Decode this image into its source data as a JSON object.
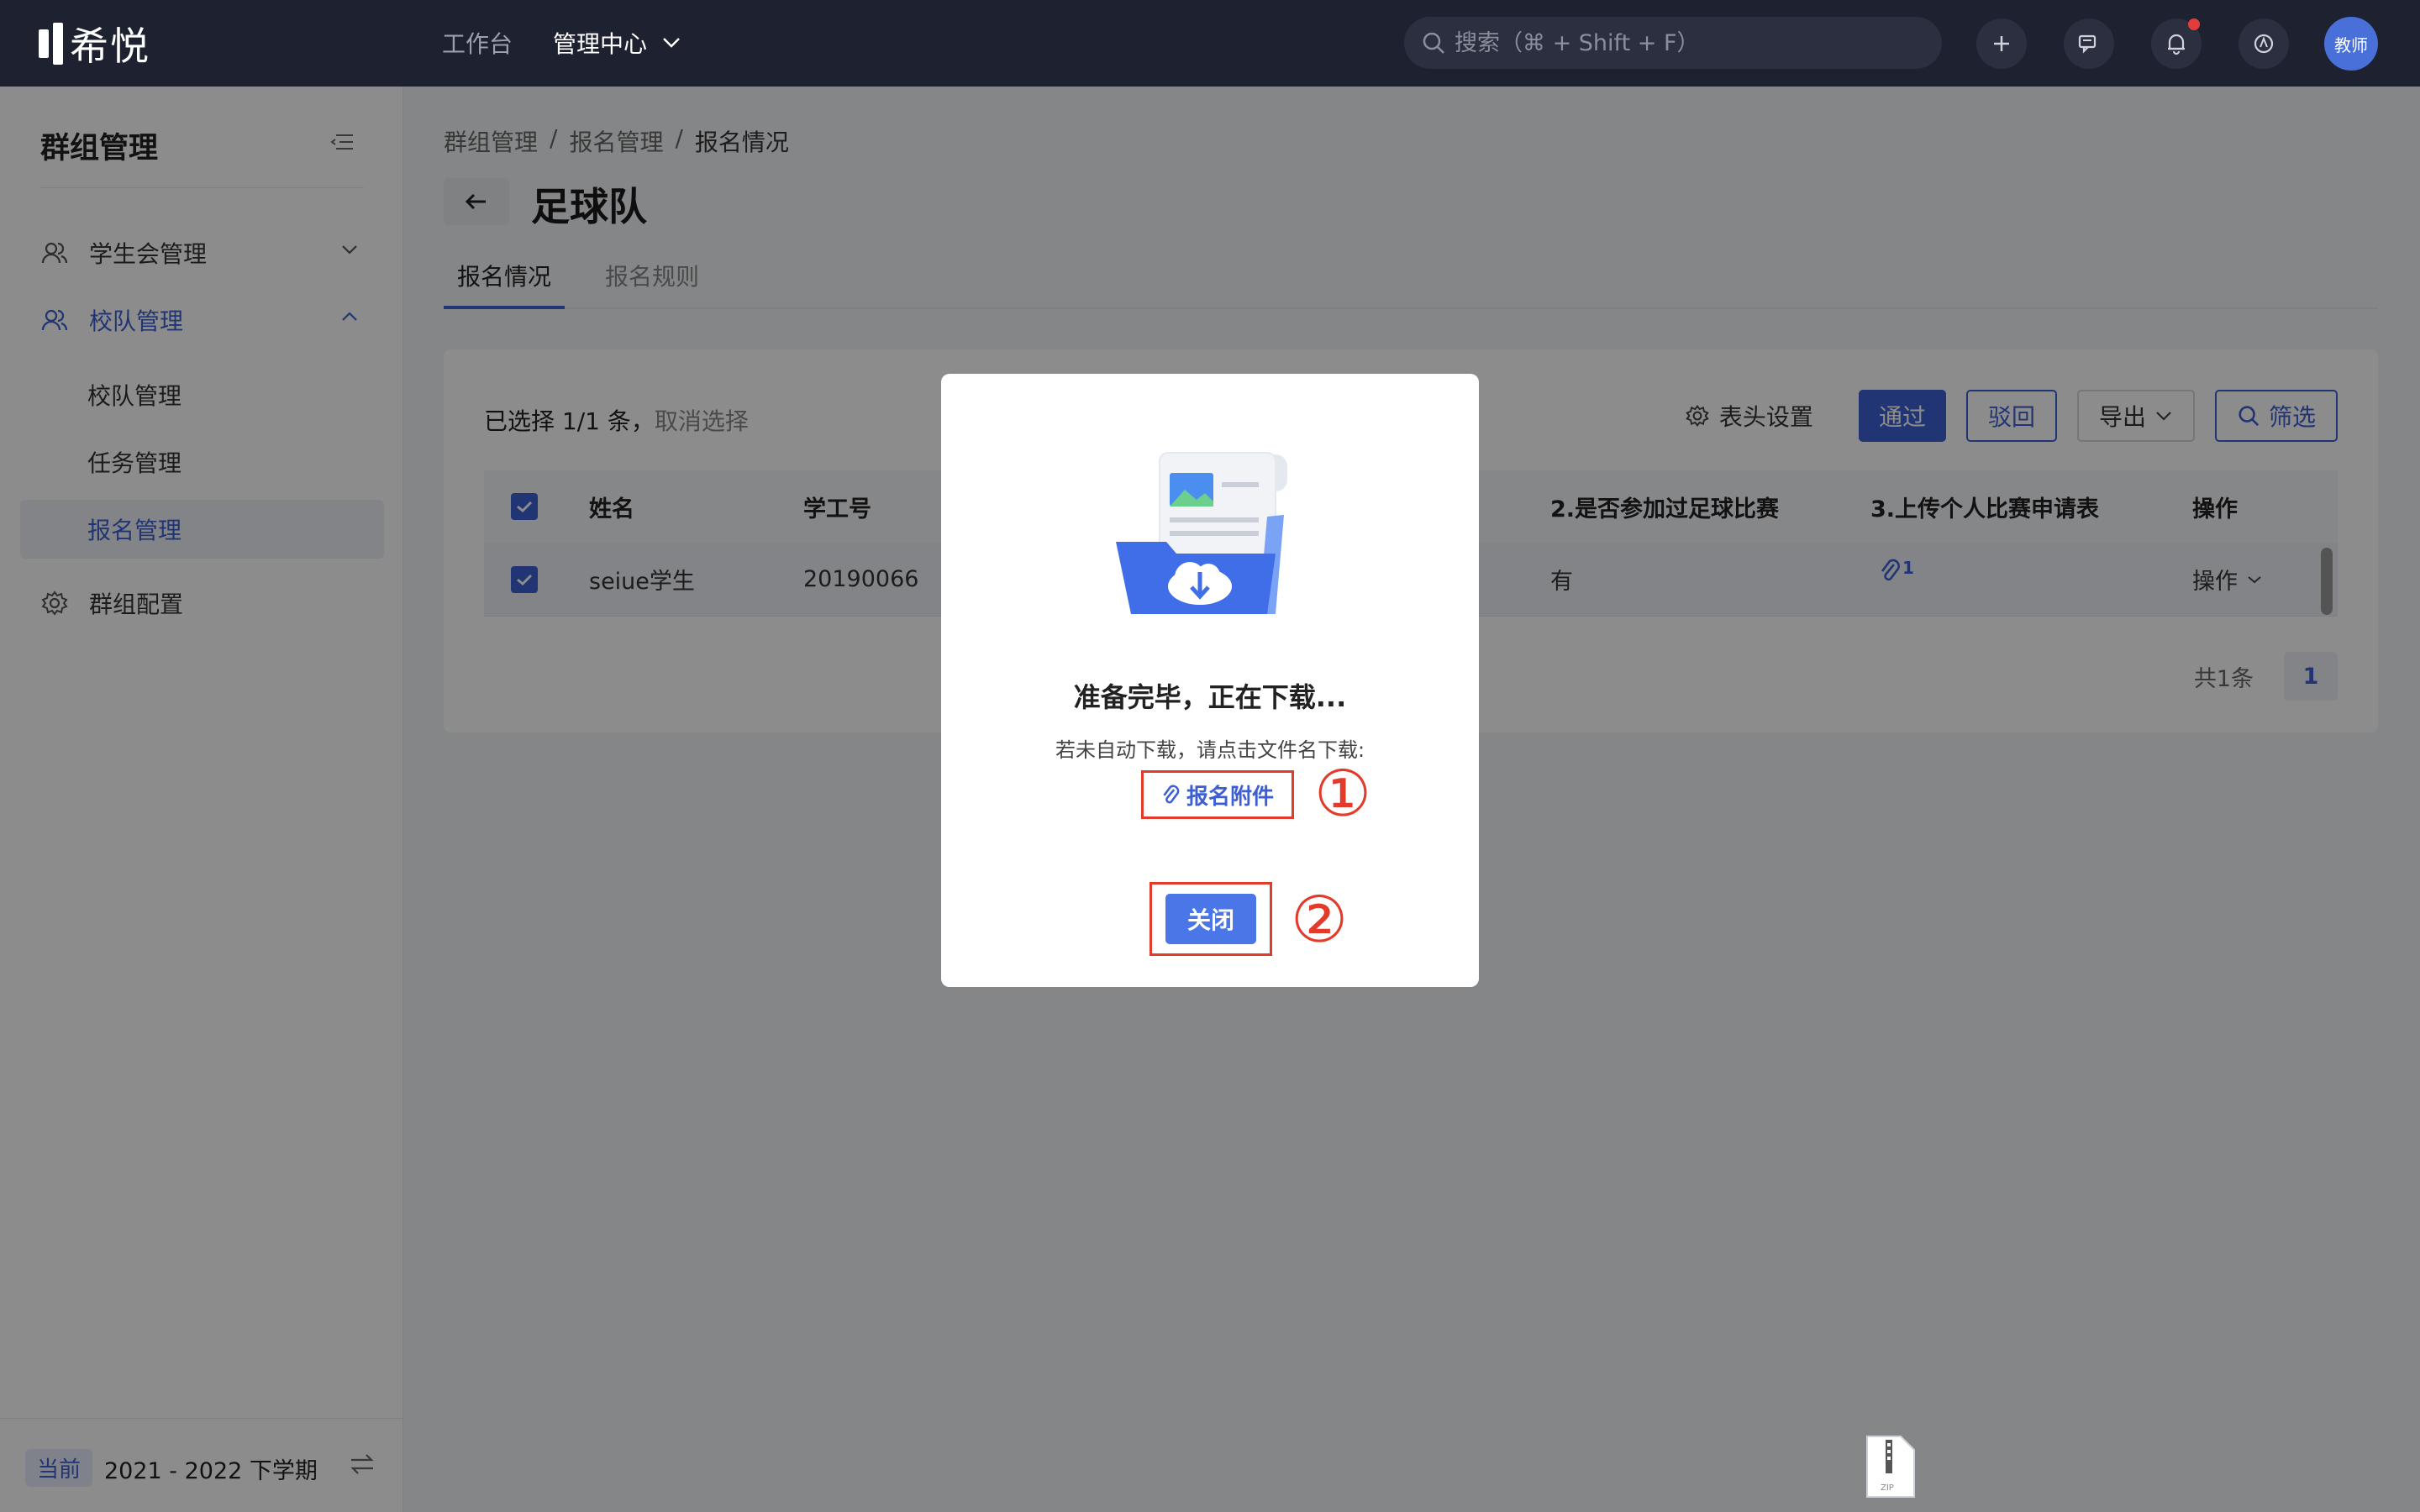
{
  "topbar": {
    "logo_text": "希悦",
    "nav": [
      "工作台",
      "管理中心"
    ],
    "search_placeholder": "搜索（⌘ + Shift + F）",
    "avatar_text": "教师"
  },
  "sidebar": {
    "title": "群组管理",
    "items": [
      {
        "label": "学生会管理"
      },
      {
        "label": "校队管理"
      },
      {
        "label": "群组配置"
      }
    ],
    "sub_items": [
      "校队管理",
      "任务管理",
      "报名管理"
    ],
    "term_badge": "当前",
    "term_text": "2021 - 2022 下学期"
  },
  "breadcrumb": [
    "群组管理",
    "/",
    "报名管理",
    "/",
    "报名情况"
  ],
  "page_title": "足球队",
  "tabs": [
    "报名情况",
    "报名规则"
  ],
  "card": {
    "selection_text": "已选择 1/1 条，",
    "cancel_selection": "取消选择",
    "header_settings": "表头设置",
    "buttons": {
      "approve": "通过",
      "reject": "驳回",
      "export": "导出",
      "filter": "筛选"
    },
    "columns": [
      "姓名",
      "学工号",
      "2.是否参加过足球比赛",
      "3.上传个人比赛申请表",
      "操作"
    ],
    "rows": [
      {
        "name": "seiue学生",
        "id": "20190066",
        "played": "有",
        "attachment_count": "1",
        "action": "操作"
      }
    ],
    "total": "共1条",
    "page": "1"
  },
  "modal": {
    "title": "准备完毕，正在下载...",
    "description": "若未自动下载，请点击文件名下载:",
    "file_label": "报名附件",
    "close_label": "关闭",
    "annotation_1": "①",
    "annotation_2": "②"
  },
  "colors": {
    "primary": "#3d5fd1",
    "annotation_red": "#e23b2c",
    "topbar": "#1e2130"
  },
  "download_icon_label": "ZIP"
}
